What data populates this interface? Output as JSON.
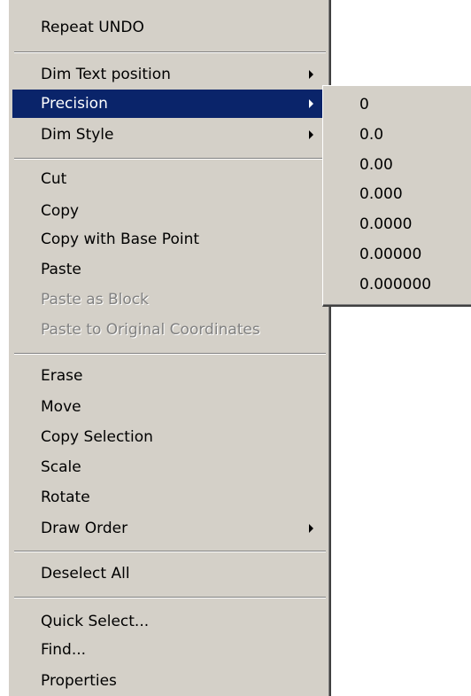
{
  "context_menu": {
    "items": [
      {
        "label": "Repeat UNDO",
        "enabled": true
      },
      {
        "label": "Dim Text position",
        "enabled": true,
        "has_submenu": true
      },
      {
        "label": "Precision",
        "enabled": true,
        "has_submenu": true,
        "highlighted": true
      },
      {
        "label": "Dim Style",
        "enabled": true,
        "has_submenu": true
      },
      {
        "label": "Cut",
        "enabled": true
      },
      {
        "label": "Copy",
        "enabled": true
      },
      {
        "label": "Copy with Base Point",
        "enabled": true
      },
      {
        "label": "Paste",
        "enabled": true
      },
      {
        "label": "Paste as Block",
        "enabled": false
      },
      {
        "label": "Paste to Original Coordinates",
        "enabled": false
      },
      {
        "label": "Erase",
        "enabled": true
      },
      {
        "label": "Move",
        "enabled": true
      },
      {
        "label": "Copy Selection",
        "enabled": true
      },
      {
        "label": "Scale",
        "enabled": true
      },
      {
        "label": "Rotate",
        "enabled": true
      },
      {
        "label": "Draw Order",
        "enabled": true,
        "has_submenu": true
      },
      {
        "label": "Deselect All",
        "enabled": true
      },
      {
        "label": "Quick Select...",
        "enabled": true
      },
      {
        "label": "Find...",
        "enabled": true
      },
      {
        "label": "Properties",
        "enabled": true
      }
    ]
  },
  "precision_submenu": {
    "items": [
      "0",
      "0.0",
      "0.00",
      "0.000",
      "0.0000",
      "0.00000",
      "0.000000"
    ]
  },
  "colors": {
    "menu_background": "#d4d0c8",
    "highlight_background": "#0a246a",
    "highlight_text": "#ffffff",
    "disabled_text": "#808080"
  },
  "icons": {
    "submenu_arrow": "submenu-arrow-icon"
  }
}
